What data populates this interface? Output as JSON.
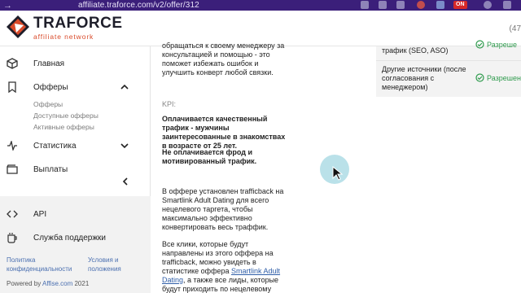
{
  "browser": {
    "nav_arrow": "→",
    "url": "affiliate.traforce.com/v2/offer/312",
    "on_badge": "ON"
  },
  "header": {
    "logo_title": "TRAFORCE",
    "logo_subtitle": "affiliate network",
    "right_counter": "(47"
  },
  "sidebar": {
    "items": [
      {
        "label": "Главная",
        "icon": "cube-icon"
      },
      {
        "label": "Офферы",
        "icon": "bookmark-icon"
      },
      {
        "label": "Статистика",
        "icon": "pulse-icon"
      },
      {
        "label": "Выплаты",
        "icon": "wallet-icon"
      },
      {
        "label": "API",
        "icon": "code-icon"
      },
      {
        "label": "Служба поддержки",
        "icon": "mug-icon"
      }
    ],
    "offer_subitems": [
      "Офферы",
      "Доступные офферы",
      "Активные офферы"
    ],
    "footer": {
      "privacy": "Политика конфиденциальности",
      "terms": "Условия и положения",
      "powered_prefix": "Powered by",
      "powered_brand": "Affise.com",
      "year": "2021"
    }
  },
  "main": {
    "intro": "обращаться к своему менеджеру за консультацией и помощью - это поможет избежать ошибок и улучшить конверт любой связки.",
    "kpi_label": "KPI:",
    "kpi_paid": "Оплачивается качественный трафик - мужчины заинтересованные в знакомствах в возрасте от 25 лет.",
    "kpi_not_paid": "Не оплачивается фрод и мотивированный трафик.",
    "trafficback": "В оффере установлен trafficback на Smartlink Adult Dating для всего нецелевого таргета, чтобы максимально эффективно конвертировать весь траффик.",
    "clicks_1": "Все клики, которые будут направлены из этого оффера на trafficback, можно увидеть в статистике оффера",
    "clicks_link": "Smartlink Adult Dating",
    "clicks_2": ", а также все лиды, которые будут приходить по нецелевому таргету."
  },
  "right_panel": {
    "rows": [
      {
        "label": "трафик (SEO, ASO)",
        "status": "Разреше"
      },
      {
        "label": "Другие источники (после согласования с менеджером)",
        "status": "Разрешен"
      }
    ]
  },
  "colors": {
    "browser_bar": "#3b1f7a",
    "logo_accent": "#d94a2a",
    "status_green": "#2e9a4c",
    "link_blue": "#2f5ea8"
  }
}
